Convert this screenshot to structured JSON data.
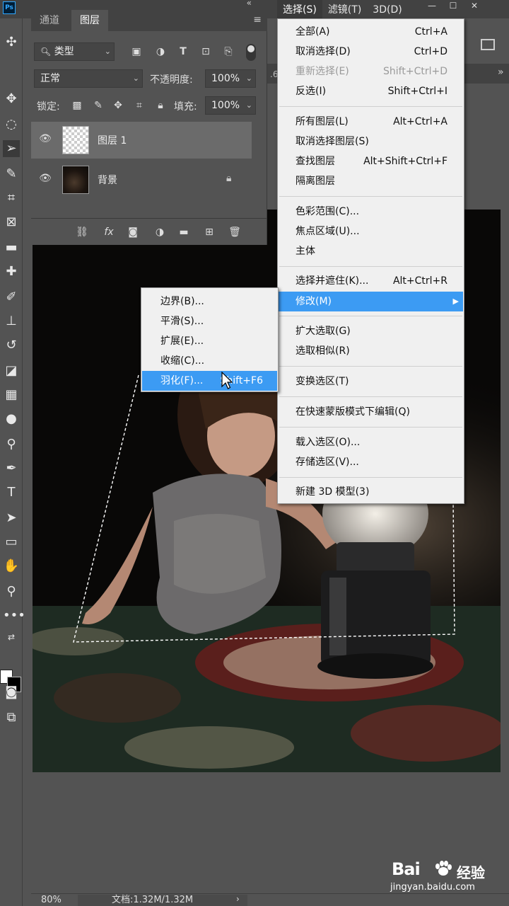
{
  "app": {
    "logo": "Ps"
  },
  "menubar": {
    "items": [
      {
        "label": "选择(S)",
        "active": true
      },
      {
        "label": "滤镜(T)",
        "active": false
      },
      {
        "label": "3D(D)",
        "active": false
      }
    ],
    "window_controls": [
      "—",
      "☐",
      "✕"
    ]
  },
  "doc_tab_fragment": ".6",
  "layers_panel": {
    "tabs": [
      "通道",
      "图层"
    ],
    "active_tab": "图层",
    "filter_kind": "类型",
    "blend_mode": "正常",
    "opacity_label": "不透明度:",
    "opacity_value": "100%",
    "lock_label": "锁定:",
    "fill_label": "填充:",
    "fill_value": "100%",
    "layers": [
      {
        "name": "图层 1",
        "selected": true,
        "thumb": "transparent",
        "locked": false
      },
      {
        "name": "背景",
        "selected": false,
        "thumb": "photo",
        "locked": true
      }
    ],
    "bottom_icons": [
      "link-icon",
      "fx-icon",
      "mask-icon",
      "adjustment-icon",
      "folder-icon",
      "new-layer-icon",
      "trash-icon"
    ],
    "fx_label": "fx"
  },
  "select_menu": {
    "groups": [
      [
        {
          "label": "全部(A)",
          "shortcut": "Ctrl+A",
          "disabled": false
        },
        {
          "label": "取消选择(D)",
          "shortcut": "Ctrl+D",
          "disabled": false
        },
        {
          "label": "重新选择(E)",
          "shortcut": "Shift+Ctrl+D",
          "disabled": true
        },
        {
          "label": "反选(I)",
          "shortcut": "Shift+Ctrl+I",
          "disabled": false
        }
      ],
      [
        {
          "label": "所有图层(L)",
          "shortcut": "Alt+Ctrl+A",
          "disabled": false
        },
        {
          "label": "取消选择图层(S)",
          "shortcut": "",
          "disabled": false
        },
        {
          "label": "查找图层",
          "shortcut": "Alt+Shift+Ctrl+F",
          "disabled": false
        },
        {
          "label": "隔离图层",
          "shortcut": "",
          "disabled": false
        }
      ],
      [
        {
          "label": "色彩范围(C)...",
          "shortcut": "",
          "disabled": false
        },
        {
          "label": "焦点区域(U)...",
          "shortcut": "",
          "disabled": false
        },
        {
          "label": "主体",
          "shortcut": "",
          "disabled": false
        }
      ],
      [
        {
          "label": "选择并遮住(K)...",
          "shortcut": "Alt+Ctrl+R",
          "disabled": false
        },
        {
          "label": "修改(M)",
          "shortcut": "",
          "disabled": false,
          "submenu": true,
          "hover": true
        }
      ],
      [
        {
          "label": "扩大选取(G)",
          "shortcut": "",
          "disabled": false
        },
        {
          "label": "选取相似(R)",
          "shortcut": "",
          "disabled": false
        }
      ],
      [
        {
          "label": "变换选区(T)",
          "shortcut": "",
          "disabled": false
        }
      ],
      [
        {
          "label": "在快速蒙版模式下编辑(Q)",
          "shortcut": "",
          "disabled": false
        }
      ],
      [
        {
          "label": "载入选区(O)...",
          "shortcut": "",
          "disabled": false
        },
        {
          "label": "存储选区(V)...",
          "shortcut": "",
          "disabled": false
        }
      ],
      [
        {
          "label": "新建 3D 模型(3)",
          "shortcut": "",
          "disabled": false
        }
      ]
    ]
  },
  "modify_menu": {
    "items": [
      {
        "label": "边界(B)...",
        "shortcut": "",
        "hover": false
      },
      {
        "label": "平滑(S)...",
        "shortcut": "",
        "hover": false
      },
      {
        "label": "扩展(E)...",
        "shortcut": "",
        "hover": false
      },
      {
        "label": "收缩(C)...",
        "shortcut": "",
        "hover": false
      },
      {
        "label": "羽化(F)...",
        "shortcut": "Shift+F6",
        "hover": true
      }
    ]
  },
  "status_bar": {
    "zoom": "80%",
    "doc_info": "文档:1.32M/1.32M",
    "arrow": "›"
  },
  "watermark": {
    "logo": "Bai",
    "cn": "经验",
    "url": "jingyan.baidu.com"
  },
  "colors": {
    "menu_highlight": "#3c9bf3",
    "panel_bg": "#535353",
    "canvas_bg": "#090807"
  }
}
